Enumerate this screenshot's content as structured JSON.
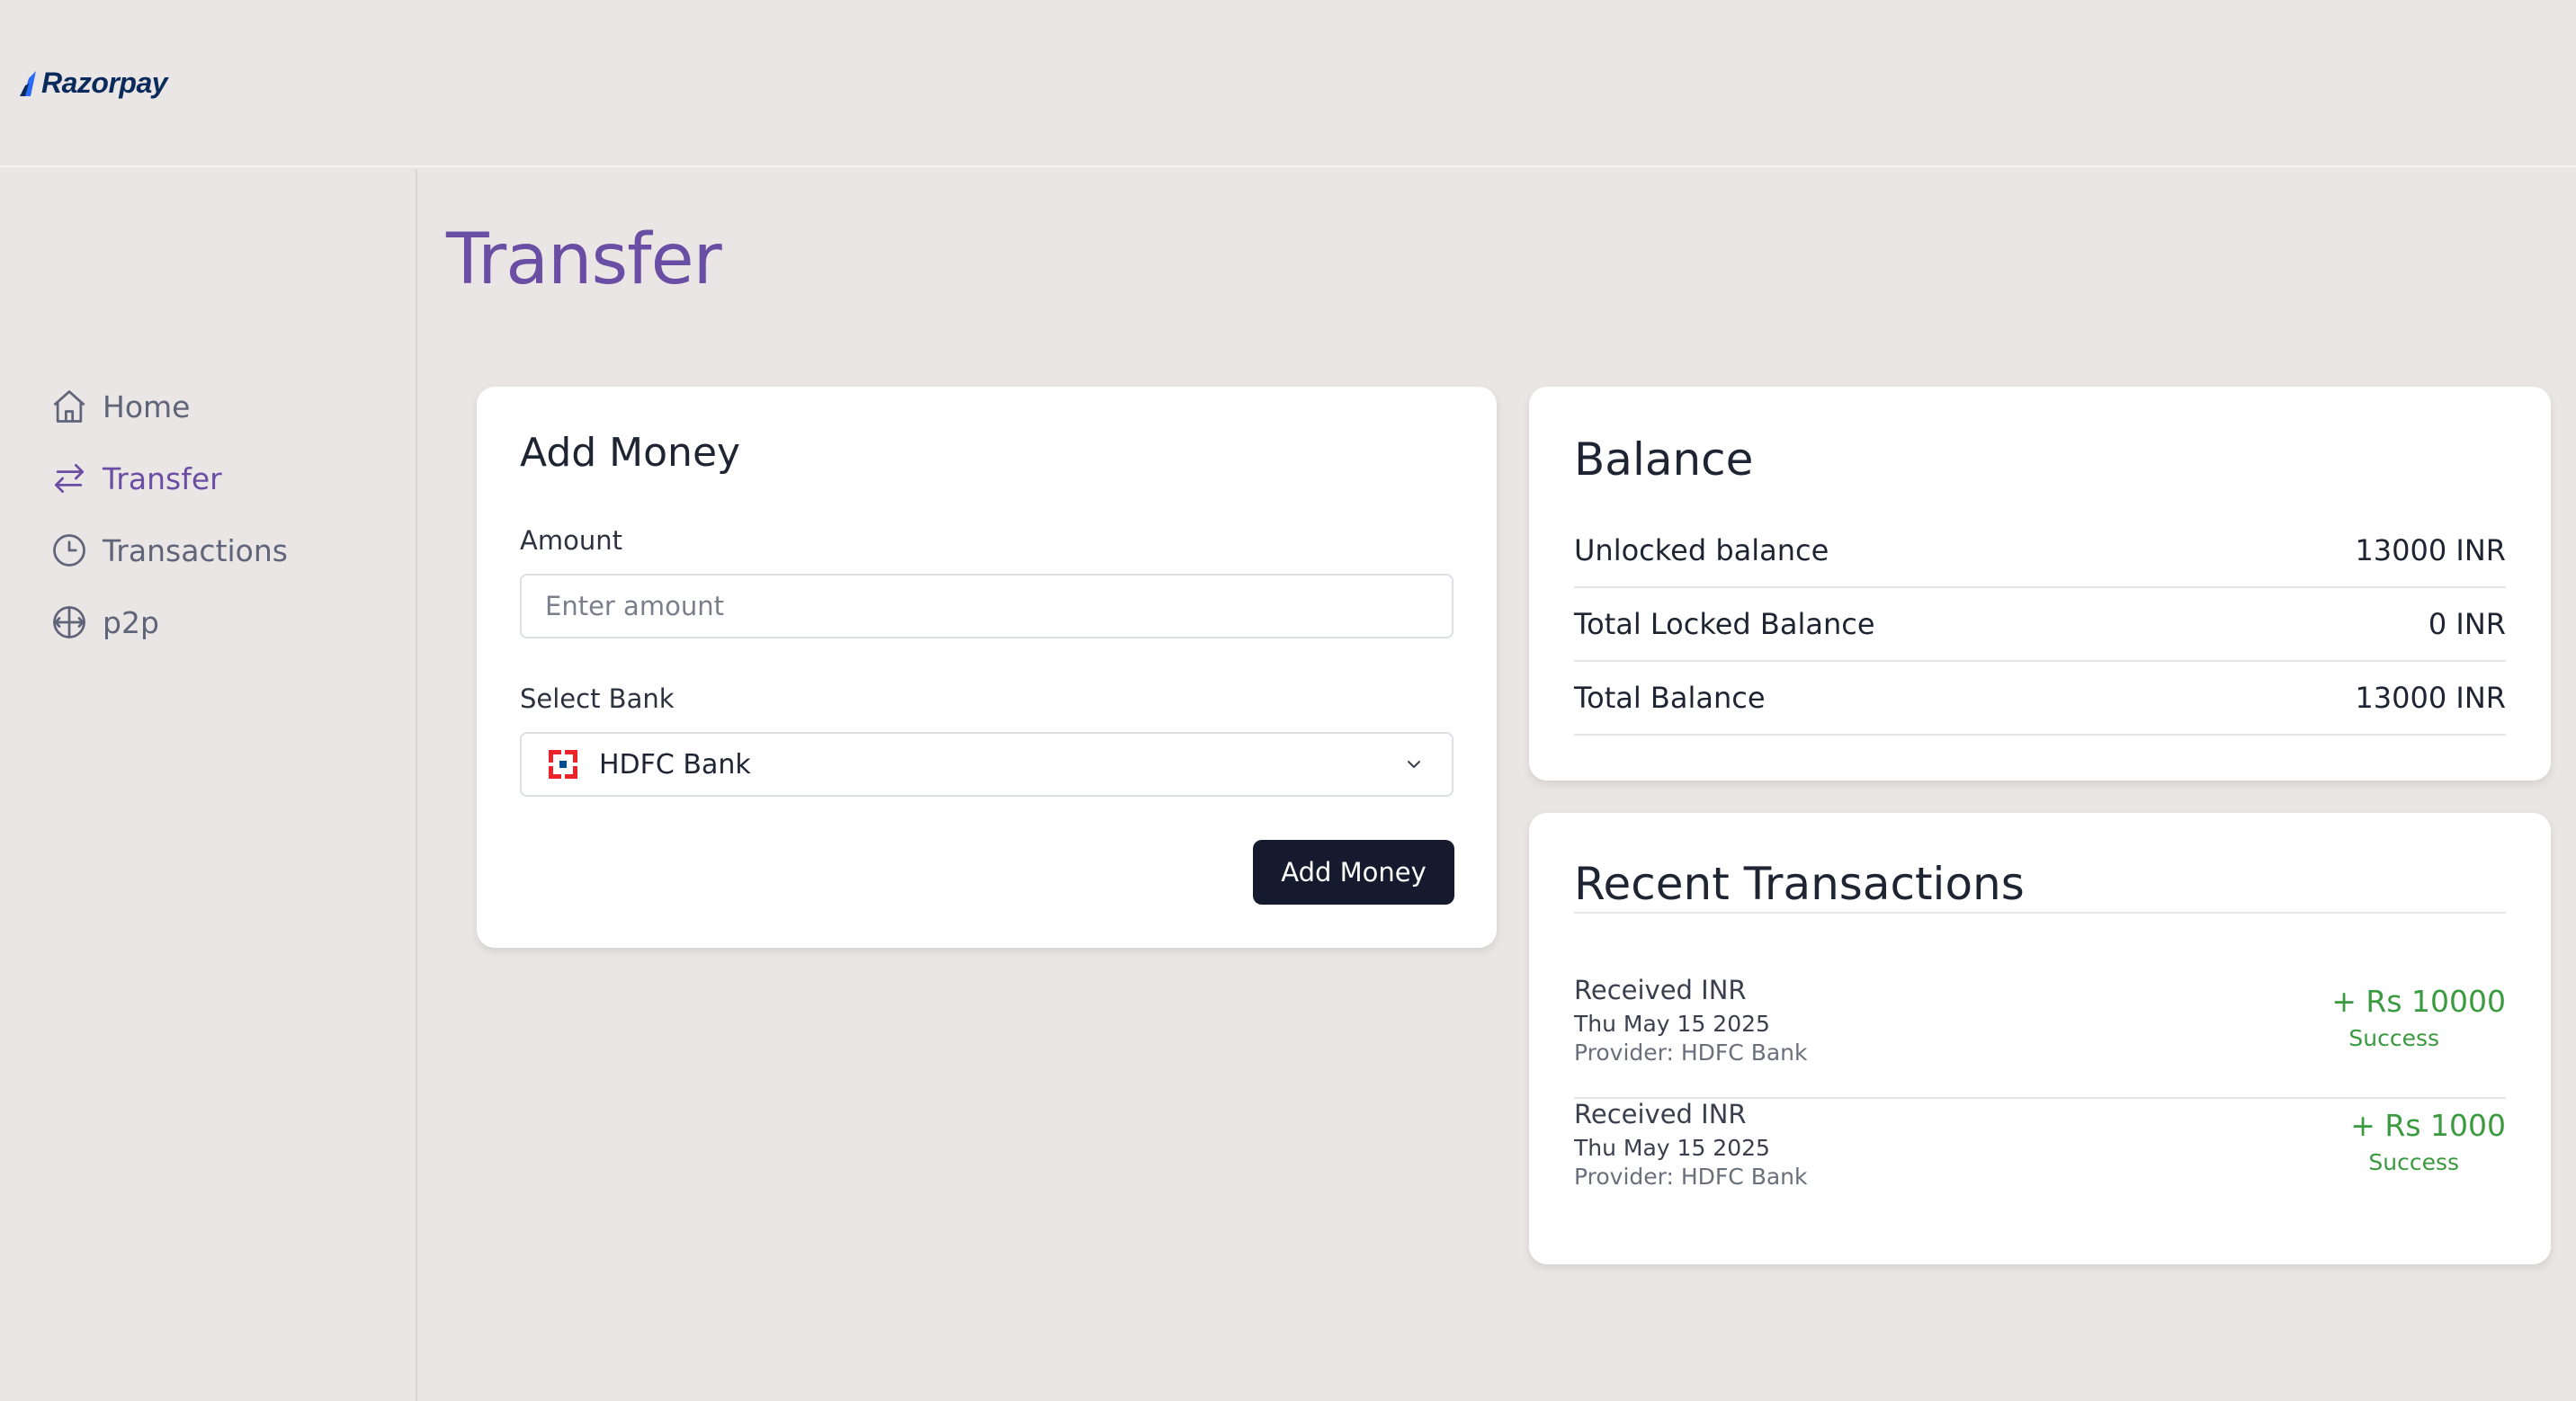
{
  "brand": {
    "name": "Razorpay"
  },
  "sidebar": {
    "items": [
      {
        "label": "Home",
        "icon": "home-icon"
      },
      {
        "label": "Transfer",
        "icon": "transfer-icon",
        "active": true
      },
      {
        "label": "Transactions",
        "icon": "clock-icon"
      },
      {
        "label": "p2p",
        "icon": "p2p-icon"
      }
    ]
  },
  "page": {
    "title": "Transfer"
  },
  "add_money": {
    "title": "Add Money",
    "amount_label": "Amount",
    "amount_placeholder": "Enter amount",
    "bank_label": "Select Bank",
    "bank_value": "HDFC Bank",
    "button_label": "Add Money"
  },
  "balance": {
    "title": "Balance",
    "rows": [
      {
        "label": "Unlocked balance",
        "value": "13000 INR"
      },
      {
        "label": "Total Locked Balance",
        "value": "0 INR"
      },
      {
        "label": "Total Balance",
        "value": "13000 INR"
      }
    ]
  },
  "recent": {
    "title": "Recent Transactions",
    "items": [
      {
        "title": "Received INR",
        "date": "Thu May 15 2025",
        "provider": "Provider: HDFC Bank",
        "amount": "+ Rs 10000",
        "status": "Success"
      },
      {
        "title": "Received INR",
        "date": "Thu May 15 2025",
        "provider": "Provider: HDFC Bank",
        "amount": "+ Rs 1000",
        "status": "Success"
      }
    ]
  },
  "colors": {
    "accent": "#6a4ea3",
    "background": "#ebe6e6",
    "button": "#151a2e",
    "success": "#3a9a3f"
  }
}
